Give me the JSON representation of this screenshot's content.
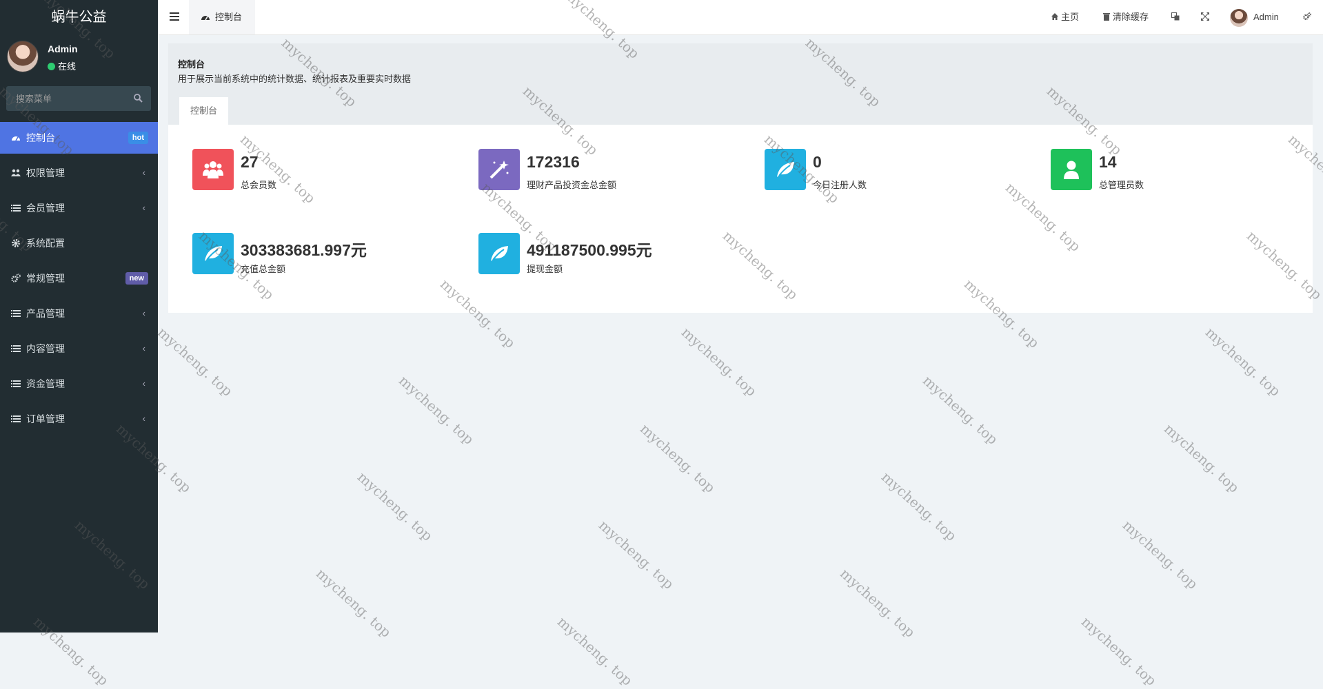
{
  "sidebar": {
    "brand": "蜗牛公益",
    "user_name": "Admin",
    "user_status": "在线",
    "search_placeholder": "搜索菜单",
    "items": [
      {
        "label": "控制台",
        "icon": "dashboard-icon",
        "badge": "hot",
        "active": true
      },
      {
        "label": "权限管理",
        "icon": "users-icon",
        "chevron": "‹"
      },
      {
        "label": "会员管理",
        "icon": "list-icon",
        "chevron": "‹"
      },
      {
        "label": "系统配置",
        "icon": "gear-icon"
      },
      {
        "label": "常规管理",
        "icon": "gears-icon",
        "badge": "new"
      },
      {
        "label": "产品管理",
        "icon": "list-icon",
        "chevron": "‹"
      },
      {
        "label": "内容管理",
        "icon": "list-icon",
        "chevron": "‹"
      },
      {
        "label": "资金管理",
        "icon": "list-icon",
        "chevron": "‹"
      },
      {
        "label": "订单管理",
        "icon": "list-icon",
        "chevron": "‹"
      }
    ]
  },
  "header": {
    "tab_label": "控制台",
    "home_label": "主页",
    "clear_cache_label": "清除缓存",
    "user_label": "Admin"
  },
  "content": {
    "title": "控制台",
    "description": "用于展示当前系统中的统计数据、统计报表及重要实时数据",
    "panel_tab": "控制台",
    "stats": [
      {
        "value": "27",
        "label": "总会员数",
        "color": "#f0525a",
        "icon": "users-icon"
      },
      {
        "value": "172316",
        "label": "理财产品投资金总金额",
        "color": "#7b69c0",
        "icon": "magic-wand-icon"
      },
      {
        "value": "0",
        "label": "今日注册人数",
        "color": "#20b0e0",
        "icon": "leaf-icon"
      },
      {
        "value": "14",
        "label": "总管理员数",
        "color": "#1ec15a",
        "icon": "user-icon"
      },
      {
        "value": "303383681.997元",
        "label": "充值总金额",
        "color": "#20b0e0",
        "icon": "leaf-icon"
      },
      {
        "value": "491187500.995元",
        "label": "提现金额",
        "color": "#20b0e0",
        "icon": "leaf-icon"
      }
    ]
  },
  "watermark_text": "mycheng. top"
}
